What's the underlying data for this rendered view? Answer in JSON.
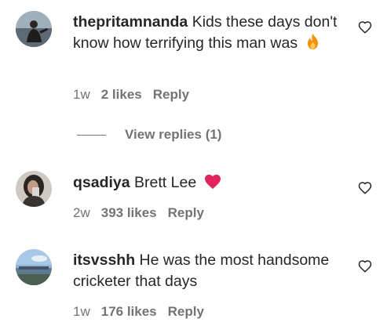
{
  "comments": [
    {
      "username": "thepritamnanda",
      "text": "Kids these days don't know how terrifying this man was",
      "emoji": "fire-emoji",
      "time": "1w",
      "likes": "2 likes",
      "reply": "Reply",
      "replies_label": "View replies (1)"
    },
    {
      "username": "qsadiya",
      "text": "Brett Lee",
      "emoji": "red-heart-emoji",
      "time": "2w",
      "likes": "393 likes",
      "reply": "Reply"
    },
    {
      "username": "itsvsshh",
      "text": "He was the most handsome cricketer that days",
      "time": "1w",
      "likes": "176 likes",
      "reply": "Reply"
    }
  ],
  "icons": {
    "like": "heart-outline-icon"
  },
  "colors": {
    "text": "#262626",
    "secondary": "#737373",
    "heart_emoji": "#e0245e",
    "fire_emoji": "#f4900c"
  }
}
